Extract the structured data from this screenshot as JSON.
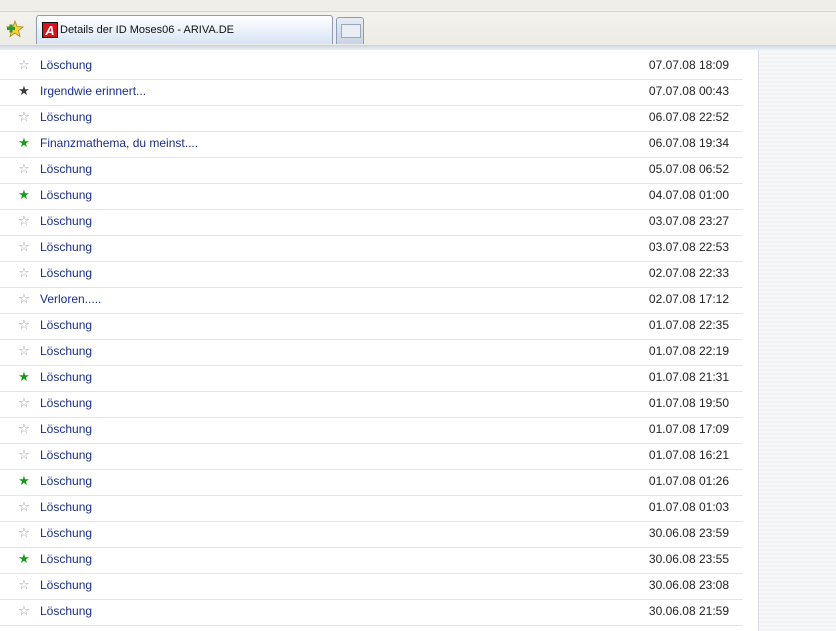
{
  "browser": {
    "active_tab_title": "Details der ID Moses06 - ARIVA.DE",
    "favicon_letter": "A",
    "add_tab_icon": "green-plus-star-icon",
    "new_tab_icon": "blank-tab-icon"
  },
  "rows": [
    {
      "title": "Löschung",
      "date": "07.07.08 18:09",
      "star": "empty"
    },
    {
      "title": "Irgendwie erinnert...",
      "date": "07.07.08 00:43",
      "star": "dark"
    },
    {
      "title": "Löschung",
      "date": "06.07.08 22:52",
      "star": "empty"
    },
    {
      "title": "Finanzmathema, du meinst....",
      "date": "06.07.08 19:34",
      "star": "green"
    },
    {
      "title": "Löschung",
      "date": "05.07.08 06:52",
      "star": "empty"
    },
    {
      "title": "Löschung",
      "date": "04.07.08 01:00",
      "star": "green"
    },
    {
      "title": "Löschung",
      "date": "03.07.08 23:27",
      "star": "empty"
    },
    {
      "title": "Löschung",
      "date": "03.07.08 22:53",
      "star": "empty"
    },
    {
      "title": "Löschung",
      "date": "02.07.08 22:33",
      "star": "empty"
    },
    {
      "title": "Verloren.....",
      "date": "02.07.08 17:12",
      "star": "empty"
    },
    {
      "title": "Löschung",
      "date": "01.07.08 22:35",
      "star": "empty"
    },
    {
      "title": "Löschung",
      "date": "01.07.08 22:19",
      "star": "empty"
    },
    {
      "title": "Löschung",
      "date": "01.07.08 21:31",
      "star": "green"
    },
    {
      "title": "Löschung",
      "date": "01.07.08 19:50",
      "star": "empty"
    },
    {
      "title": "Löschung",
      "date": "01.07.08 17:09",
      "star": "empty"
    },
    {
      "title": "Löschung",
      "date": "01.07.08 16:21",
      "star": "empty"
    },
    {
      "title": "Löschung",
      "date": "01.07.08 01:26",
      "star": "green"
    },
    {
      "title": "Löschung",
      "date": "01.07.08 01:03",
      "star": "empty"
    },
    {
      "title": "Löschung",
      "date": "30.06.08 23:59",
      "star": "empty"
    },
    {
      "title": "Löschung",
      "date": "30.06.08 23:55",
      "star": "green"
    },
    {
      "title": "Löschung",
      "date": "30.06.08 23:08",
      "star": "empty"
    },
    {
      "title": "Löschung",
      "date": "30.06.08 21:59",
      "star": "empty"
    }
  ]
}
